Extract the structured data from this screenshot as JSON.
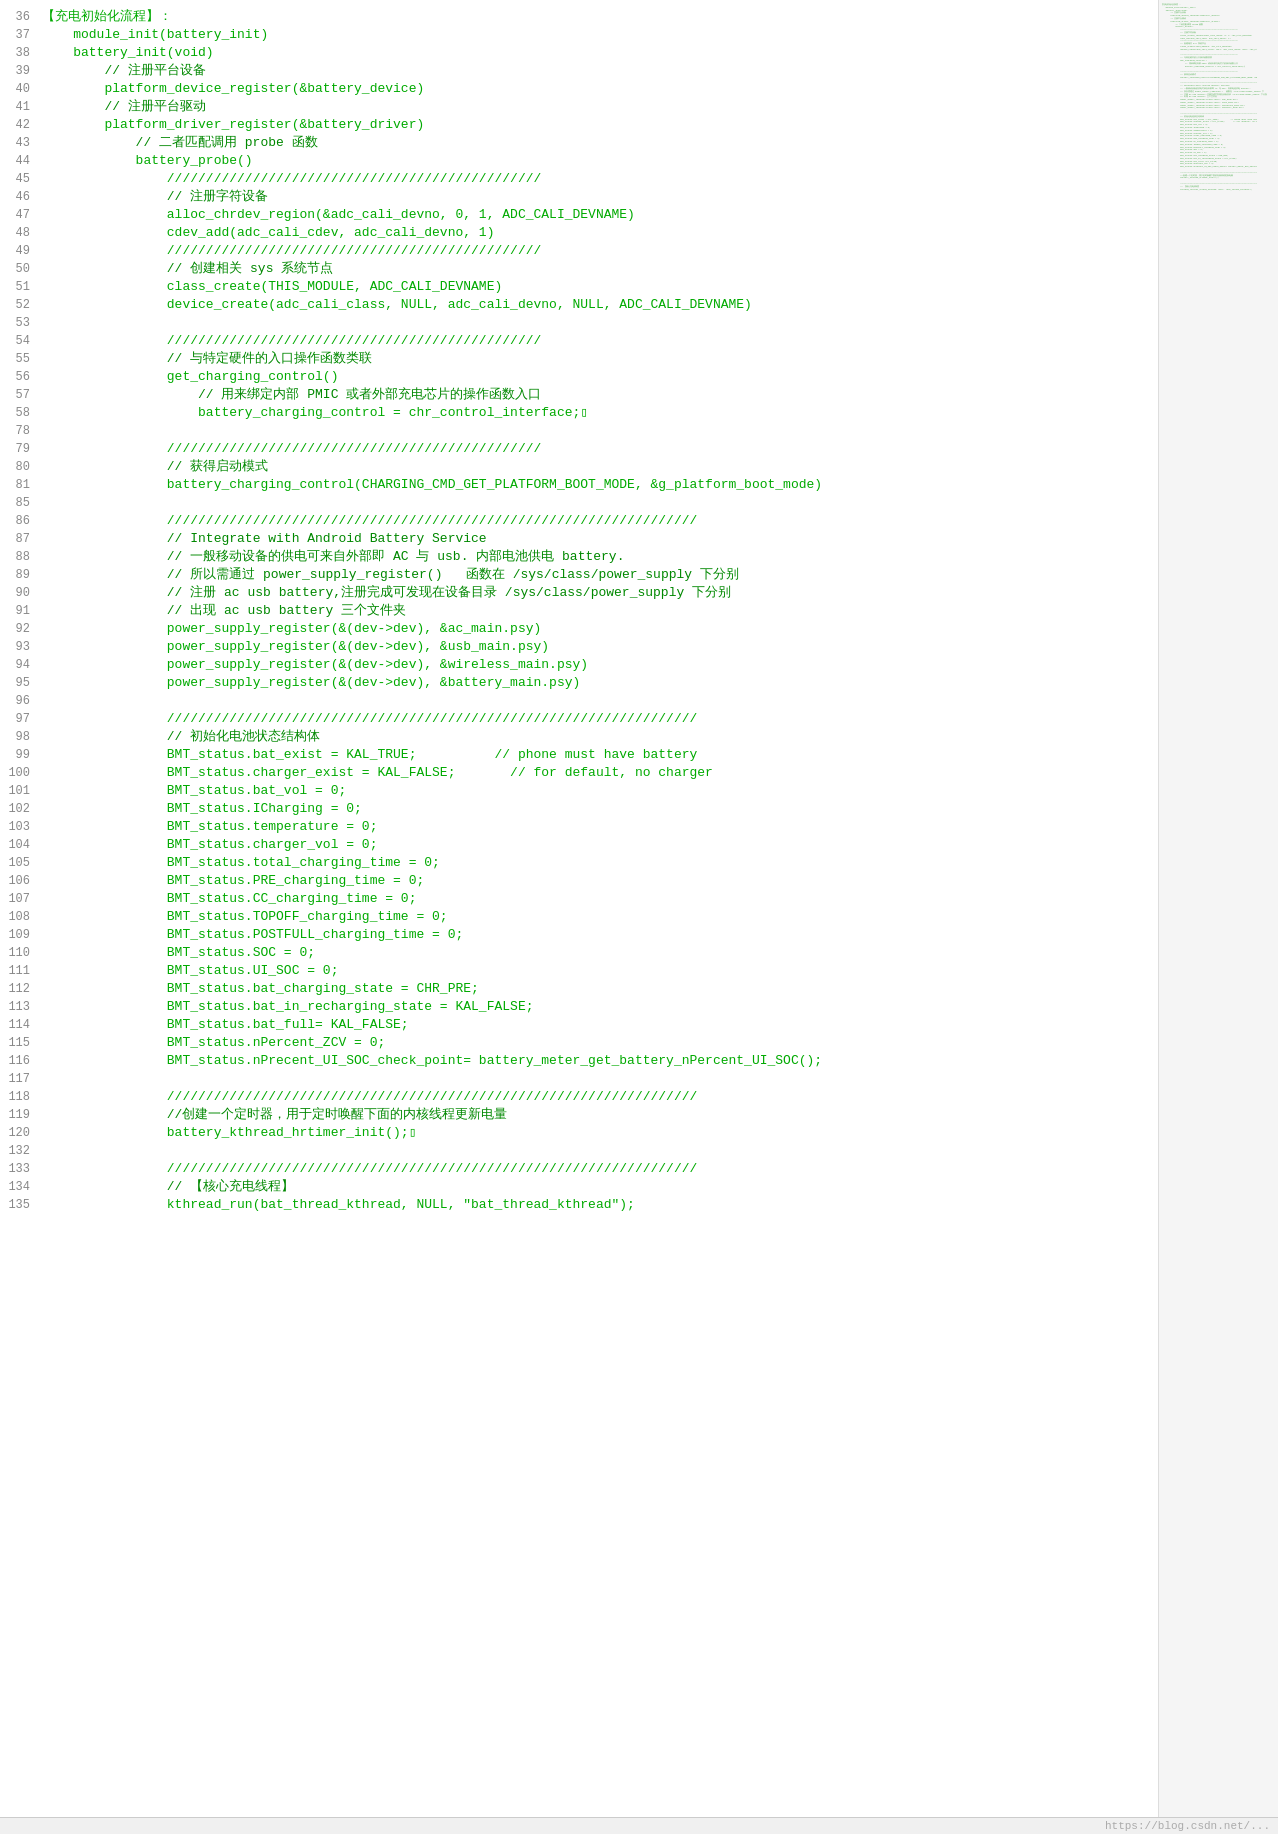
{
  "code": {
    "lines": [
      {
        "num": "36",
        "content": "【充电初始化流程】：",
        "cls": "c-green"
      },
      {
        "num": "37",
        "content": "    module_init(battery_init)",
        "cls": "c-green"
      },
      {
        "num": "38",
        "content": "    battery_init(void)",
        "cls": "c-green"
      },
      {
        "num": "39",
        "content": "        // 注册平台设备",
        "cls": "c-comment"
      },
      {
        "num": "40",
        "content": "        platform_device_register(&battery_device)",
        "cls": "c-green"
      },
      {
        "num": "41",
        "content": "        // 注册平台驱动",
        "cls": "c-comment"
      },
      {
        "num": "42",
        "content": "        platform_driver_register(&battery_driver)",
        "cls": "c-green"
      },
      {
        "num": "43",
        "content": "            // 二者匹配调用 probe 函数",
        "cls": "c-comment"
      },
      {
        "num": "44",
        "content": "            battery_probe()",
        "cls": "c-green"
      },
      {
        "num": "45",
        "content": "                ////////////////////////////////////////////////",
        "cls": "c-green"
      },
      {
        "num": "46",
        "content": "                // 注册字符设备",
        "cls": "c-comment"
      },
      {
        "num": "47",
        "content": "                alloc_chrdev_region(&adc_cali_devno, 0, 1, ADC_CALI_DEVNAME)",
        "cls": "c-green"
      },
      {
        "num": "48",
        "content": "                cdev_add(adc_cali_cdev, adc_cali_devno, 1)",
        "cls": "c-green"
      },
      {
        "num": "49",
        "content": "                ////////////////////////////////////////////////",
        "cls": "c-green"
      },
      {
        "num": "50",
        "content": "                // 创建相关 sys 系统节点",
        "cls": "c-comment"
      },
      {
        "num": "51",
        "content": "                class_create(THIS_MODULE, ADC_CALI_DEVNAME)",
        "cls": "c-green"
      },
      {
        "num": "52",
        "content": "                device_create(adc_cali_class, NULL, adc_cali_devno, NULL, ADC_CALI_DEVNAME)",
        "cls": "c-green"
      },
      {
        "num": "53",
        "content": "",
        "cls": ""
      },
      {
        "num": "54",
        "content": "                ////////////////////////////////////////////////",
        "cls": "c-green"
      },
      {
        "num": "55",
        "content": "                // 与特定硬件的入口操作函数类联",
        "cls": "c-comment"
      },
      {
        "num": "56",
        "content": "                get_charging_control()",
        "cls": "c-green"
      },
      {
        "num": "57",
        "content": "                    // 用来绑定内部 PMIC 或者外部充电芯片的操作函数入口",
        "cls": "c-comment"
      },
      {
        "num": "58",
        "content": "                    battery_charging_control = chr_control_interface;▯",
        "cls": "c-green"
      },
      {
        "num": "78",
        "content": "",
        "cls": ""
      },
      {
        "num": "79",
        "content": "                ////////////////////////////////////////////////",
        "cls": "c-green"
      },
      {
        "num": "80",
        "content": "                // 获得启动模式",
        "cls": "c-comment"
      },
      {
        "num": "81",
        "content": "                battery_charging_control(CHARGING_CMD_GET_PLATFORM_BOOT_MODE, &g_platform_boot_mode)",
        "cls": "c-green"
      },
      {
        "num": "85",
        "content": "",
        "cls": ""
      },
      {
        "num": "86",
        "content": "                ////////////////////////////////////////////////////////////////////",
        "cls": "c-green"
      },
      {
        "num": "87",
        "content": "                // Integrate with Android Battery Service",
        "cls": "c-comment"
      },
      {
        "num": "88",
        "content": "                // 一般移动设备的供电可来自外部即 AC 与 usb. 内部电池供电 battery.",
        "cls": "c-comment"
      },
      {
        "num": "89",
        "content": "                // 所以需通过 power_supply_register()   函数在 /sys/class/power_supply 下分别",
        "cls": "c-comment"
      },
      {
        "num": "90",
        "content": "                // 注册 ac usb battery,注册完成可发现在设备目录 /sys/class/power_supply 下分别",
        "cls": "c-comment"
      },
      {
        "num": "91",
        "content": "                // 出现 ac usb battery 三个文件夹",
        "cls": "c-comment"
      },
      {
        "num": "92",
        "content": "                power_supply_register(&(dev->dev), &ac_main.psy)",
        "cls": "c-green"
      },
      {
        "num": "93",
        "content": "                power_supply_register(&(dev->dev), &usb_main.psy)",
        "cls": "c-green"
      },
      {
        "num": "94",
        "content": "                power_supply_register(&(dev->dev), &wireless_main.psy)",
        "cls": "c-green"
      },
      {
        "num": "95",
        "content": "                power_supply_register(&(dev->dev), &battery_main.psy)",
        "cls": "c-green"
      },
      {
        "num": "96",
        "content": "",
        "cls": ""
      },
      {
        "num": "97",
        "content": "                ////////////////////////////////////////////////////////////////////",
        "cls": "c-green"
      },
      {
        "num": "98",
        "content": "                // 初始化电池状态结构体",
        "cls": "c-comment"
      },
      {
        "num": "99",
        "content": "                BMT_status.bat_exist = KAL_TRUE;          // phone must have battery",
        "cls": "c-green"
      },
      {
        "num": "100",
        "content": "                BMT_status.charger_exist = KAL_FALSE;       // for default, no charger",
        "cls": "c-green"
      },
      {
        "num": "101",
        "content": "                BMT_status.bat_vol = 0;",
        "cls": "c-green"
      },
      {
        "num": "102",
        "content": "                BMT_status.ICharging = 0;",
        "cls": "c-green"
      },
      {
        "num": "103",
        "content": "                BMT_status.temperature = 0;",
        "cls": "c-green"
      },
      {
        "num": "104",
        "content": "                BMT_status.charger_vol = 0;",
        "cls": "c-green"
      },
      {
        "num": "105",
        "content": "                BMT_status.total_charging_time = 0;",
        "cls": "c-green"
      },
      {
        "num": "106",
        "content": "                BMT_status.PRE_charging_time = 0;",
        "cls": "c-green"
      },
      {
        "num": "107",
        "content": "                BMT_status.CC_charging_time = 0;",
        "cls": "c-green"
      },
      {
        "num": "108",
        "content": "                BMT_status.TOPOFF_charging_time = 0;",
        "cls": "c-green"
      },
      {
        "num": "109",
        "content": "                BMT_status.POSTFULL_charging_time = 0;",
        "cls": "c-green"
      },
      {
        "num": "110",
        "content": "                BMT_status.SOC = 0;",
        "cls": "c-green"
      },
      {
        "num": "111",
        "content": "                BMT_status.UI_SOC = 0;",
        "cls": "c-green"
      },
      {
        "num": "112",
        "content": "                BMT_status.bat_charging_state = CHR_PRE;",
        "cls": "c-green"
      },
      {
        "num": "113",
        "content": "                BMT_status.bat_in_recharging_state = KAL_FALSE;",
        "cls": "c-green"
      },
      {
        "num": "114",
        "content": "                BMT_status.bat_full= KAL_FALSE;",
        "cls": "c-green"
      },
      {
        "num": "115",
        "content": "                BMT_status.nPercent_ZCV = 0;",
        "cls": "c-green"
      },
      {
        "num": "116",
        "content": "                BMT_status.nPrecent_UI_SOC_check_point= battery_meter_get_battery_nPercent_UI_SOC();",
        "cls": "c-green"
      },
      {
        "num": "117",
        "content": "",
        "cls": ""
      },
      {
        "num": "118",
        "content": "                ////////////////////////////////////////////////////////////////////",
        "cls": "c-green"
      },
      {
        "num": "119",
        "content": "                //创建一个定时器，用于定时唤醒下面的内核线程更新电量",
        "cls": "c-comment"
      },
      {
        "num": "120",
        "content": "                battery_kthread_hrtimer_init();▯",
        "cls": "c-green"
      },
      {
        "num": "132",
        "content": "",
        "cls": ""
      },
      {
        "num": "133",
        "content": "                ////////////////////////////////////////////////////////////////////",
        "cls": "c-green"
      },
      {
        "num": "134",
        "content": "                // 【核心充电线程】",
        "cls": "c-comment"
      },
      {
        "num": "135",
        "content": "                kthread_run(bat_thread_kthread, NULL, \"bat_thread_kthread\");",
        "cls": "c-green"
      }
    ],
    "watermark": "https://blog.csdn.net/..."
  }
}
